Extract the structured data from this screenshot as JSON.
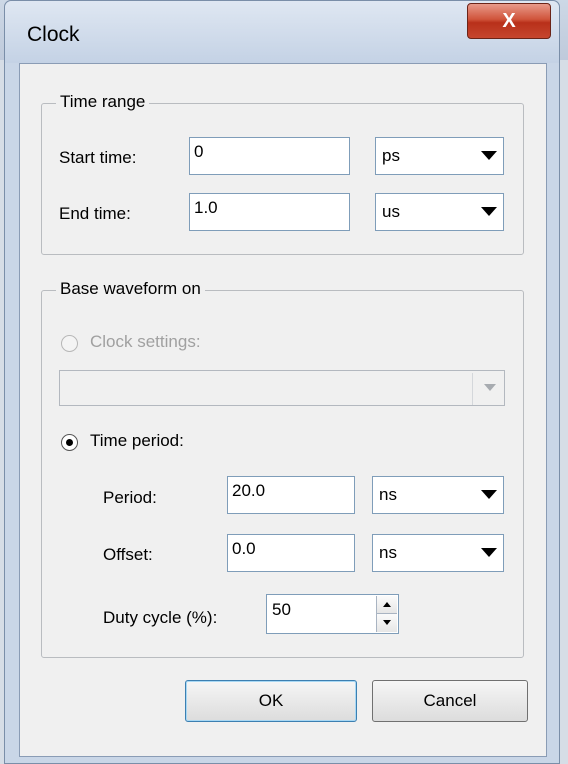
{
  "window": {
    "title": "Clock",
    "close_glyph": "X"
  },
  "time_range": {
    "legend": "Time range",
    "start_label": "Start time:",
    "start_value": "0",
    "start_unit": "ps",
    "end_label": "End time:",
    "end_value": "1.0",
    "end_unit": "us"
  },
  "base_waveform": {
    "legend": "Base waveform on",
    "clock_settings_label": "Clock settings:",
    "clock_settings_value": "",
    "time_period_label": "Time period:",
    "period_label": "Period:",
    "period_value": "20.0",
    "period_unit": "ns",
    "offset_label": "Offset:",
    "offset_value": "0.0",
    "offset_unit": "ns",
    "duty_label": "Duty cycle (%):",
    "duty_value": "50"
  },
  "buttons": {
    "ok": "OK",
    "cancel": "Cancel"
  }
}
